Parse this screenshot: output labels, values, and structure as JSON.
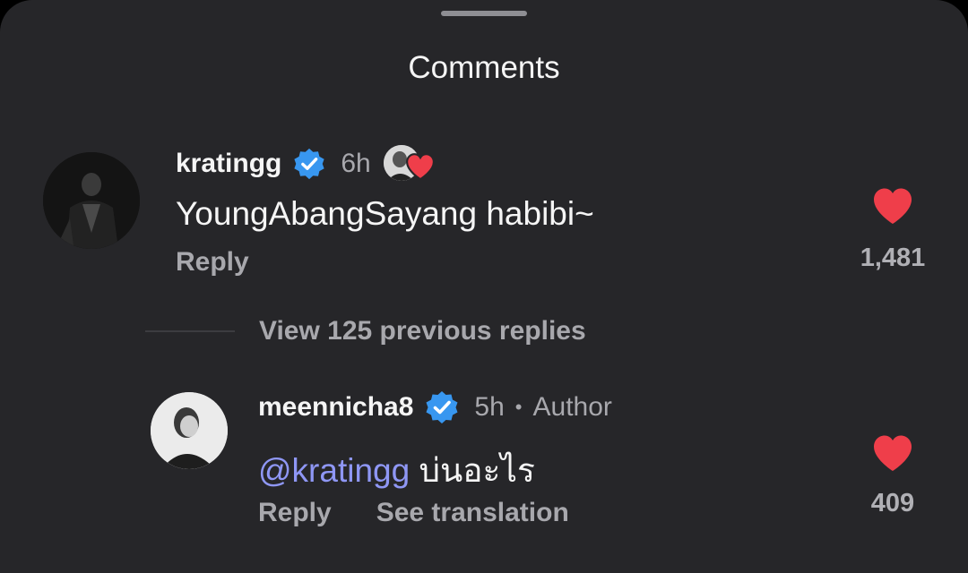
{
  "sheet": {
    "title": "Comments"
  },
  "comments": [
    {
      "username": "kratingg",
      "verified": true,
      "time": "6h",
      "text": "YoungAbangSayang habibi~",
      "actions": [
        "Reply"
      ],
      "like_count": "1,481",
      "liked": true,
      "liked_by_author": true
    },
    {
      "username": "meennicha8",
      "verified": true,
      "time": "5h",
      "separator": "•",
      "badge": "Author",
      "mention": "@kratingg",
      "text": " บ่นอะไร",
      "actions": [
        "Reply",
        "See translation"
      ],
      "like_count": "409",
      "liked": true
    }
  ],
  "view_replies": "View 125 previous replies",
  "colors": {
    "background": "#262629",
    "heart": "#ef3e4a",
    "verified": "#3897f0",
    "mention": "#8f97f5"
  },
  "icons": [
    "verified-badge-icon",
    "heart-icon",
    "liked-by-author-icon",
    "drag-handle"
  ]
}
